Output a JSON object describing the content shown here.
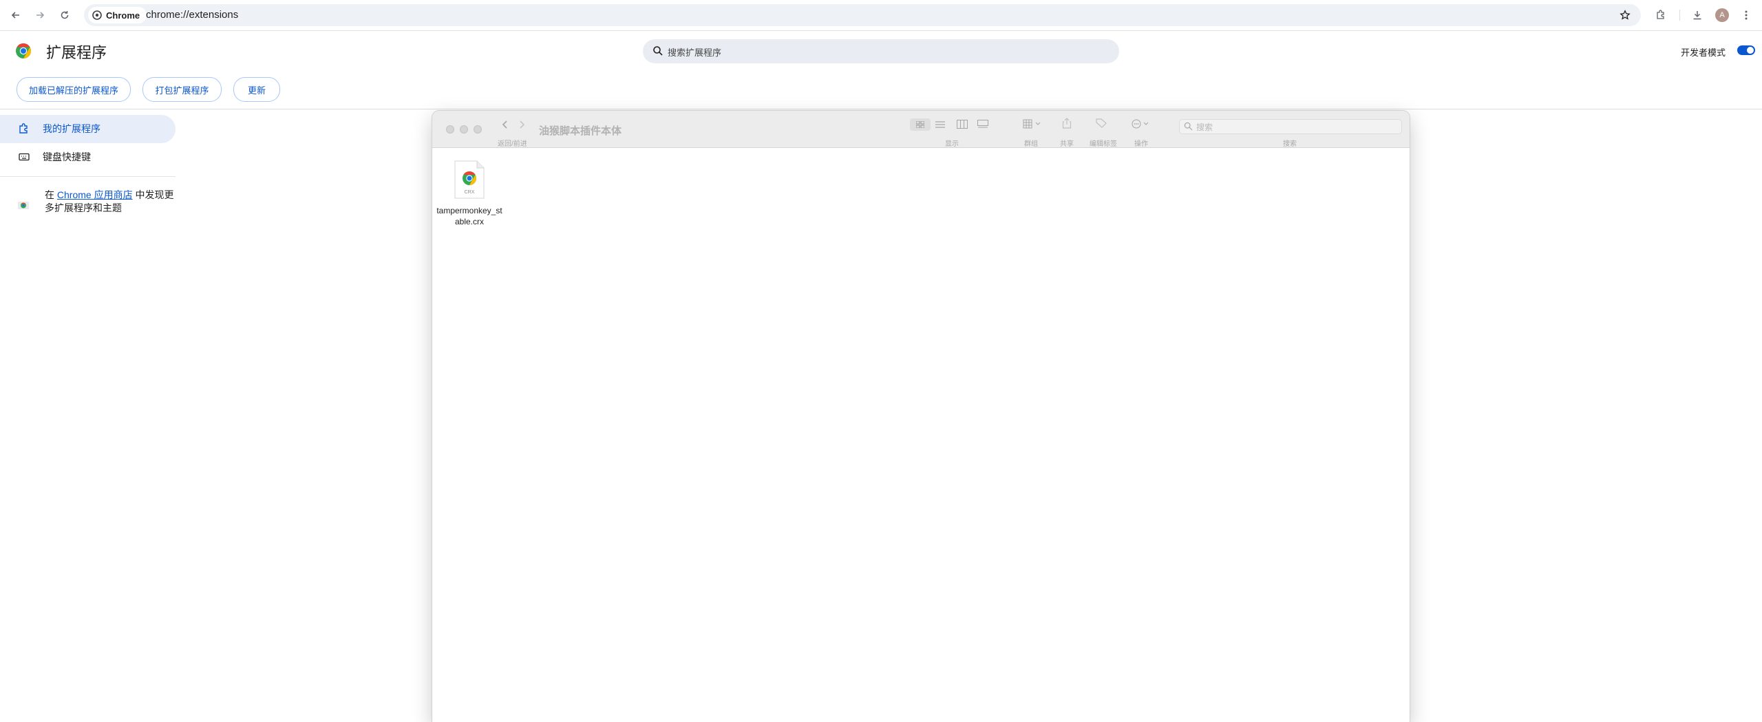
{
  "browser": {
    "chip_label": "Chrome",
    "url": "chrome://extensions",
    "avatar_letter": "A"
  },
  "header": {
    "title": "扩展程序",
    "search_placeholder": "搜索扩展程序",
    "dev_mode_label": "开发者模式",
    "dev_mode_on": true
  },
  "actions": {
    "load_unpacked": "加载已解压的扩展程序",
    "pack": "打包扩展程序",
    "update": "更新"
  },
  "sidebar": {
    "items": [
      {
        "label": "我的扩展程序"
      },
      {
        "label": "键盘快捷键"
      }
    ],
    "store_prefix": "在",
    "store_link": "Chrome 应用商店",
    "store_suffix": "中发现更多扩展程序和主题"
  },
  "finder": {
    "title": "油猴脚本插件本体",
    "labels": {
      "back_forward": "返回/前进",
      "view": "显示",
      "group": "群组",
      "share": "共享",
      "tags": "编辑标签",
      "action": "操作",
      "search": "搜索"
    },
    "search_placeholder": "搜索",
    "files": [
      {
        "name": "tampermonkey_stable.crx",
        "badge": "CRX"
      }
    ]
  },
  "colors": {
    "accent": "#0b57d0",
    "active_bg": "#e8eef9",
    "omnibox_bg": "#eef1f6"
  }
}
